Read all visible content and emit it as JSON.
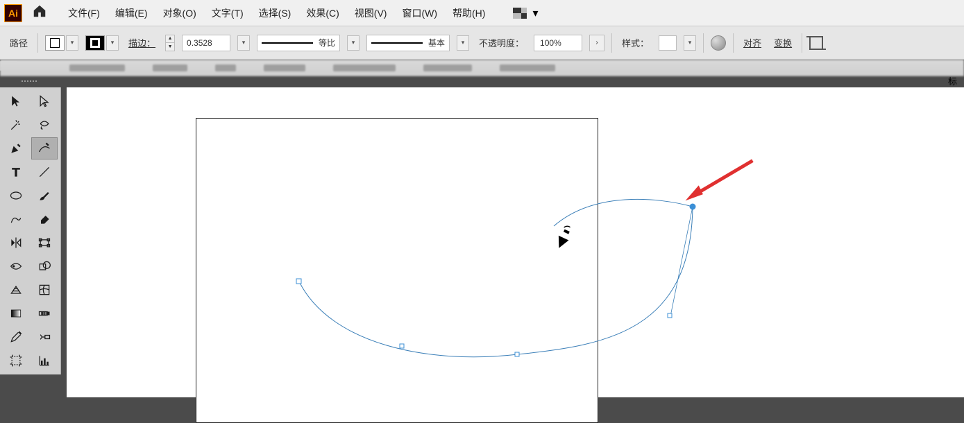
{
  "menu": {
    "file": "文件(F)",
    "edit": "编辑(E)",
    "object": "对象(O)",
    "text": "文字(T)",
    "select": "选择(S)",
    "effect": "效果(C)",
    "view": "视图(V)",
    "window": "窗口(W)",
    "help": "帮助(H)"
  },
  "options": {
    "selection_label": "路径",
    "stroke_label": "描边：",
    "stroke_weight": "0.3528",
    "profile_label": "等比",
    "brush_label": "基本",
    "opacity_label": "不透明度：",
    "opacity_value": "100%",
    "style_label": "样式：",
    "align_btn": "对齐",
    "transform_btn": "变换"
  },
  "tabstrip": {
    "right_mark": "标"
  },
  "collapse_glyph": "‹‹",
  "icons": {
    "home": "⌂",
    "chevron_down": "▾",
    "step_up": "▲",
    "step_down": "▼",
    "arrow_right": "›"
  }
}
